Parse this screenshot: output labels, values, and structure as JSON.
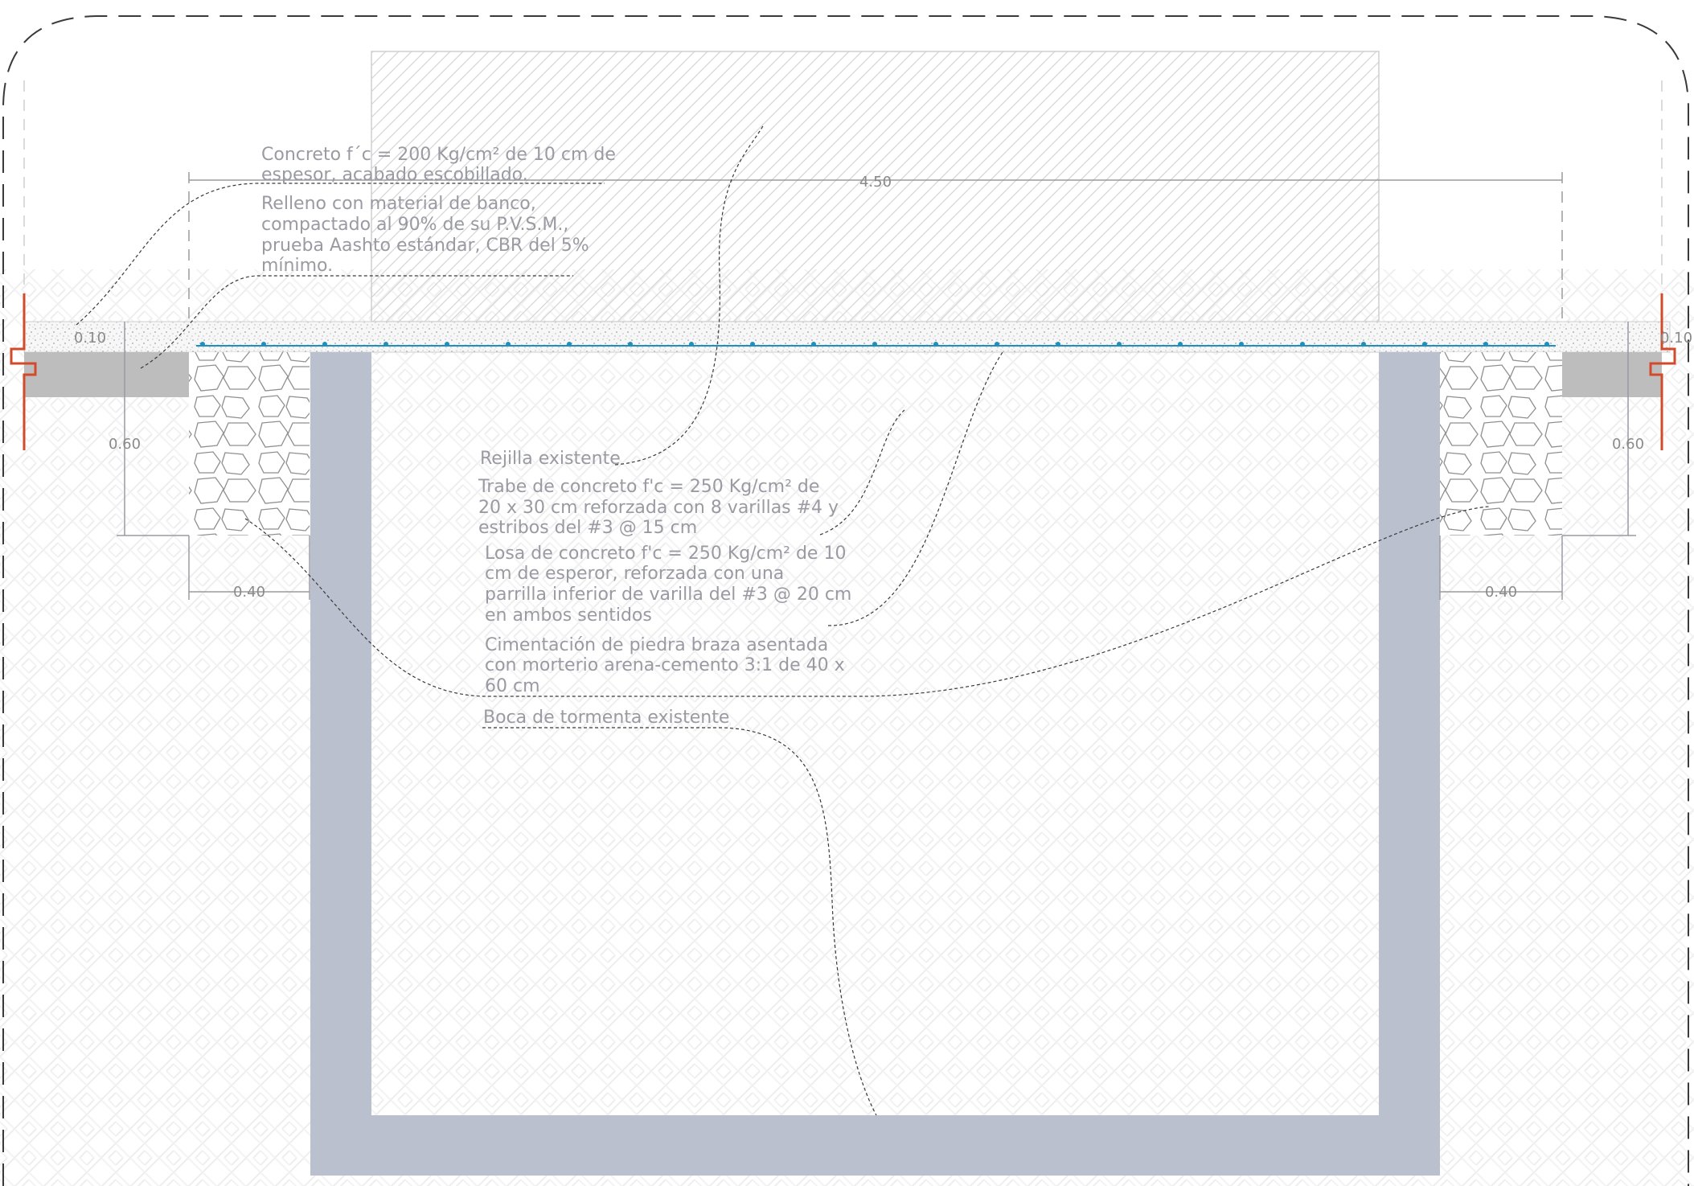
{
  "drawing": {
    "type": "construction-section",
    "colors": {
      "concrete_box": "#bbc0cf",
      "slab_blue_line": "#1f8fbf",
      "rebar_dot": "#1f8fbf",
      "label_text": "#9a9aa3",
      "dimension_line": "#9a9aa3",
      "curb_accent": "#d24a2a",
      "curb_fill": "#bdbdbd",
      "hatch": "#cfcfcf",
      "soil_pattern": "#f2f2f2",
      "frame_dash": "#3a3a3a"
    }
  },
  "dimensions": {
    "overall_width": "4.50",
    "slab_thickness_left": "0.10",
    "slab_thickness_right": "0.10",
    "footing_depth_left": "0.60",
    "footing_depth_right": "0.60",
    "footing_width_left": "0.40",
    "footing_width_right": "0.40"
  },
  "notes": {
    "top_concrete": [
      "Concreto f´c = 200 Kg/cm² de 10 cm de",
      "espesor, acabado escobillado."
    ],
    "fill": [
      "Relleno con material de banco,",
      "compactado al 90% de su P.V.S.M.,",
      "prueba Aashto estándar, CBR del 5%",
      "mínimo."
    ],
    "grate": [
      "Rejilla existente"
    ],
    "beam": [
      "Trabe de concreto f'c = 250 Kg/cm² de",
      "20 x 30 cm reforzada con 8 varillas #4 y",
      "estribos del #3 @ 15 cm"
    ],
    "slab": [
      "Losa de concreto f'c = 250 Kg/cm² de 10",
      "cm de esperor, reforzada con una",
      "parrilla inferior de varilla del #3 @ 20 cm",
      "en ambos sentidos"
    ],
    "foundation": [
      "Cimentación de piedra braza asentada",
      "con morterio arena-cemento 3:1 de 40 x",
      "60 cm"
    ],
    "storm_drain": [
      "Boca de tormenta existente"
    ]
  }
}
